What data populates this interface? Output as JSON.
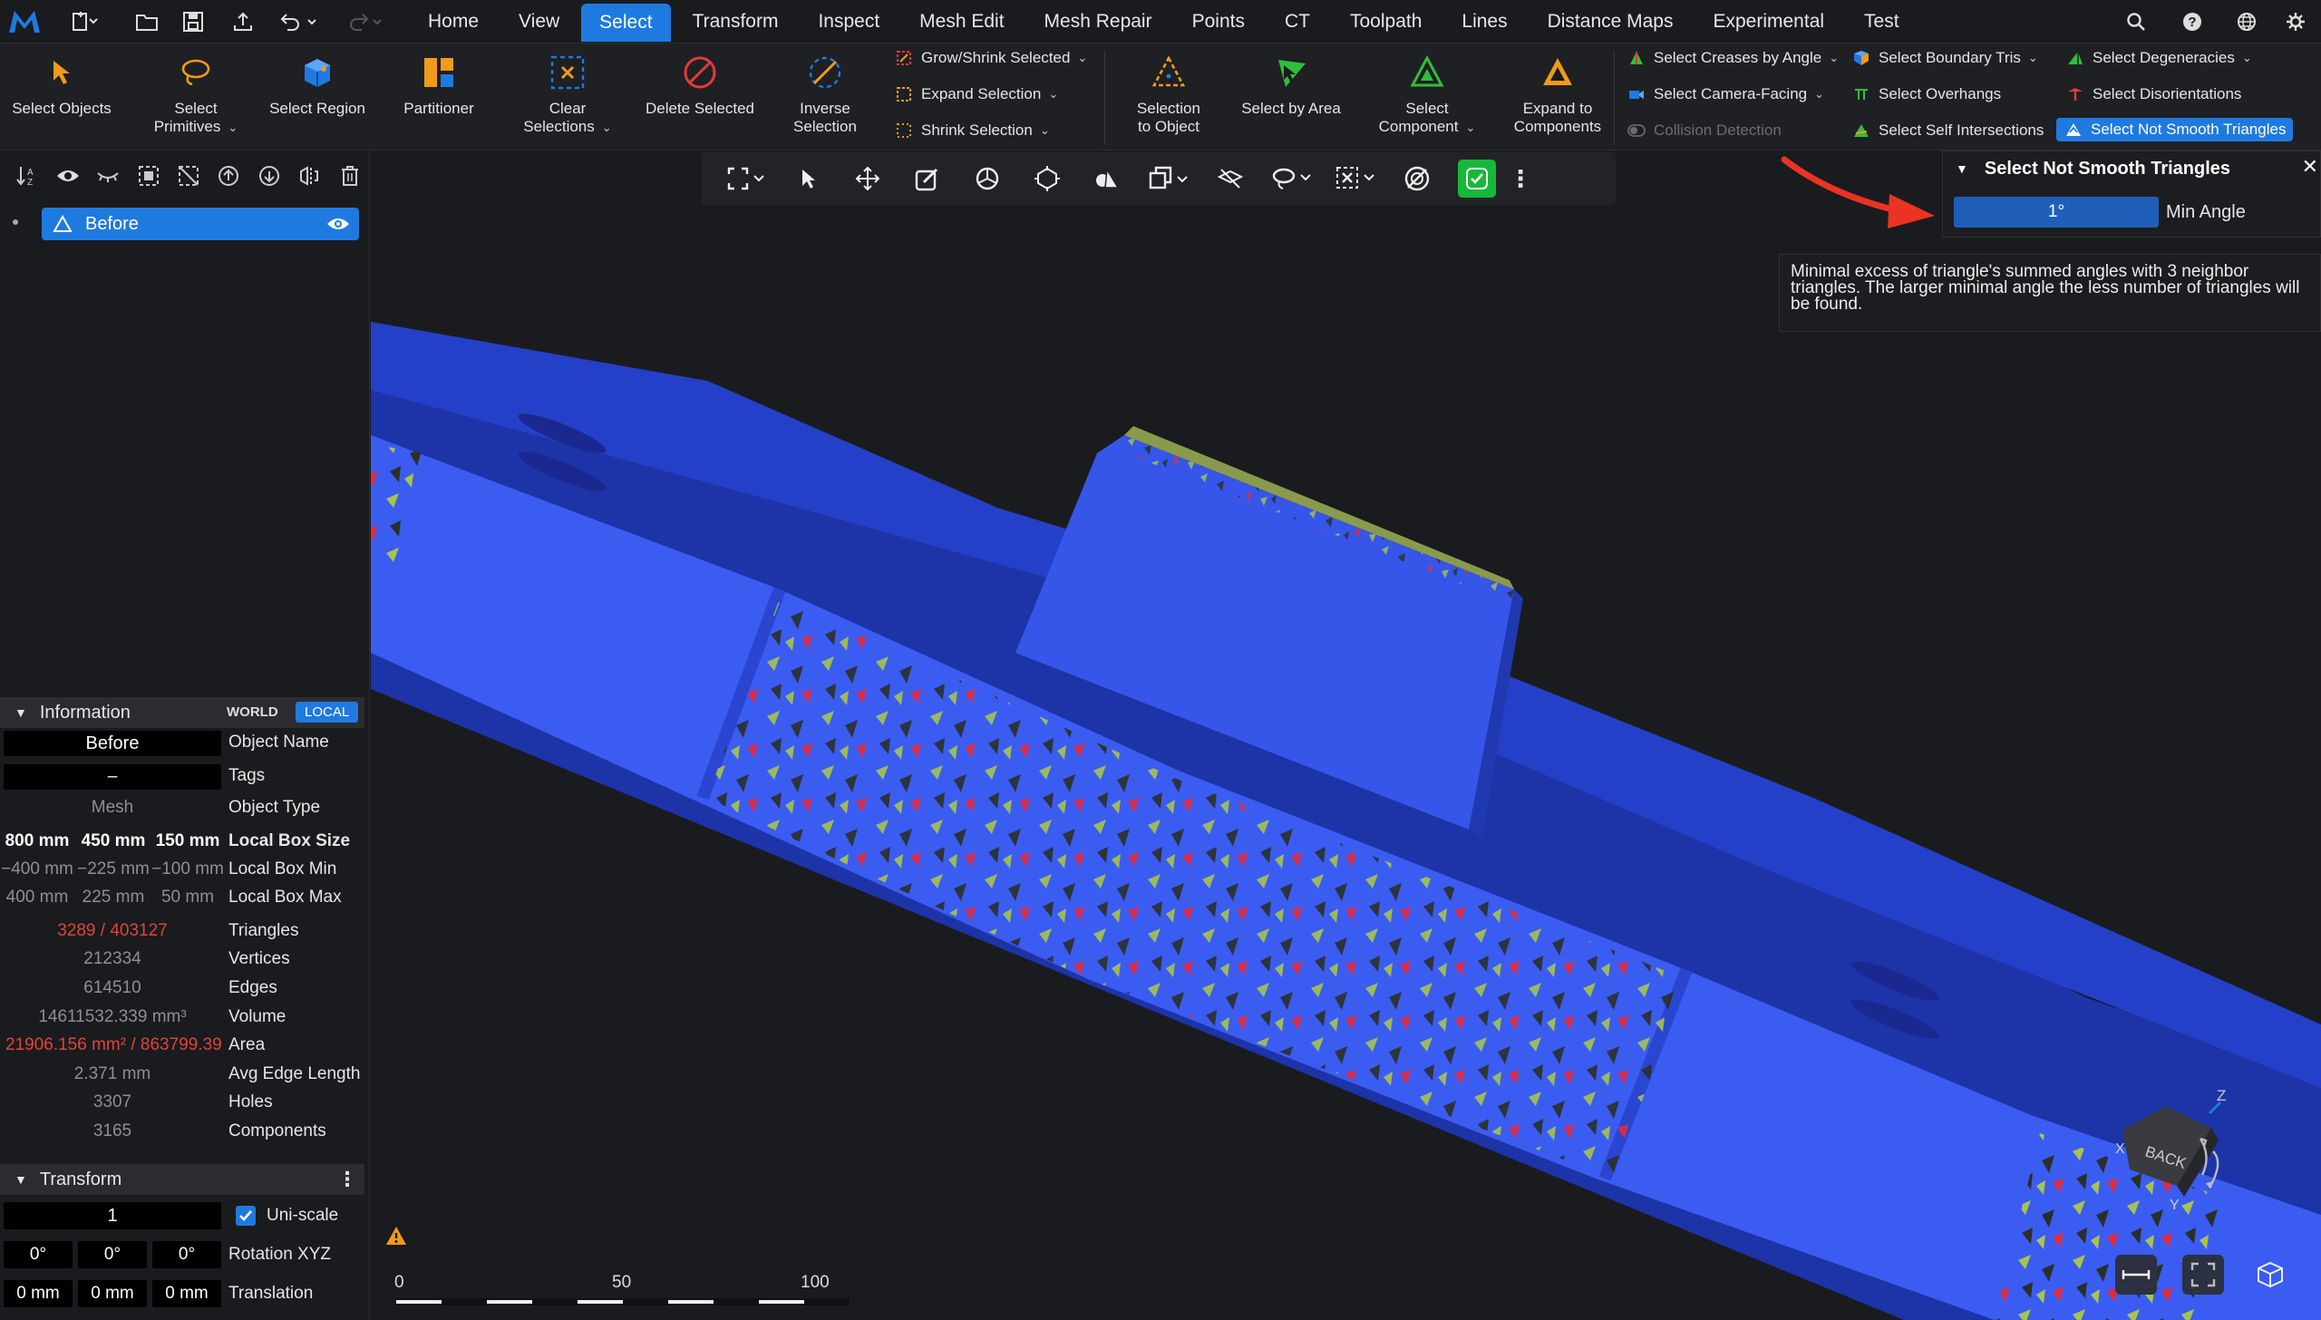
{
  "app": {
    "accent": "#1f7ae0"
  },
  "menu": {
    "tabs": [
      "Home",
      "View",
      "Select",
      "Transform",
      "Inspect",
      "Mesh Edit",
      "Mesh Repair",
      "Points",
      "CT",
      "Toolpath",
      "Lines",
      "Distance Maps",
      "Experimental",
      "Test"
    ],
    "active_tab": "Select"
  },
  "ribbon": {
    "select_objects": "Select Objects",
    "select_primitives": [
      "Select",
      "Primitives"
    ],
    "select_region": "Select Region",
    "partitioner": "Partitioner",
    "clear_selections": [
      "Clear",
      "Selections"
    ],
    "delete_selected": "Delete Selected",
    "inverse_selection": [
      "Inverse",
      "Selection"
    ],
    "grow_shrink": "Grow/Shrink Selected",
    "expand_selection": "Expand Selection",
    "shrink_selection": "Shrink Selection",
    "selection_to_object": [
      "Selection",
      "to Object"
    ],
    "select_by_area": "Select by Area",
    "select_component": [
      "Select",
      "Component"
    ],
    "expand_to_components": [
      "Expand to",
      "Components"
    ],
    "creases": "Select Creases by Angle",
    "camera_facing": "Select Camera-Facing",
    "collision": "Collision Detection",
    "boundary_tris": "Select Boundary Tris",
    "overhangs": "Select Overhangs",
    "self_intersections": "Select Self Intersections",
    "degeneracies": "Select Degeneracies",
    "disorientations": "Select Disorientations",
    "not_smooth": "Select Not Smooth Triangles"
  },
  "scene": {
    "object_name": "Before"
  },
  "info": {
    "title": "Information",
    "world": "WORLD",
    "local": "LOCAL",
    "object_name_value": "Before",
    "object_name_label": "Object Name",
    "tags_value": "–",
    "tags_label": "Tags",
    "type_value": "Mesh",
    "type_label": "Object Type",
    "box_size": [
      "800 mm",
      "450 mm",
      "150 mm"
    ],
    "box_size_label": "Local Box Size",
    "box_min": [
      "−400 mm",
      "−225 mm",
      "−100 mm"
    ],
    "box_min_label": "Local Box Min",
    "box_max": [
      "400 mm",
      "225 mm",
      "50 mm"
    ],
    "box_max_label": "Local Box Max",
    "triangles": "3289 / 403127",
    "triangles_label": "Triangles",
    "vertices": "212334",
    "vertices_label": "Vertices",
    "edges": "614510",
    "edges_label": "Edges",
    "volume": "14611532.339 mm³",
    "volume_label": "Volume",
    "area": "21906.156 mm² / 863799.39",
    "area_label": "Area",
    "avg_edge": "2.371 mm",
    "avg_edge_label": "Avg Edge Length",
    "holes": "3307",
    "holes_label": "Holes",
    "components": "3165",
    "components_label": "Components"
  },
  "transform": {
    "title": "Transform",
    "scale": "1",
    "uniscale_label": "Uni-scale",
    "rotation": [
      "0°",
      "0°",
      "0°"
    ],
    "rotation_label": "Rotation XYZ",
    "translation": [
      "0 mm",
      "0 mm",
      "0 mm"
    ],
    "translation_label": "Translation"
  },
  "popup": {
    "title": "Select Not Smooth Triangles",
    "min_angle_value": "1°",
    "min_angle_label": "Min Angle"
  },
  "tooltip": {
    "text": "Minimal excess of triangle's summed angles with 3 neighbor triangles. The larger minimal angle the less number of triangles will be found."
  },
  "scale_bar": {
    "labels": [
      "0",
      "50",
      "100"
    ]
  },
  "navcube": {
    "face": "BACK",
    "axes": [
      "Z",
      "X",
      "Y"
    ]
  }
}
